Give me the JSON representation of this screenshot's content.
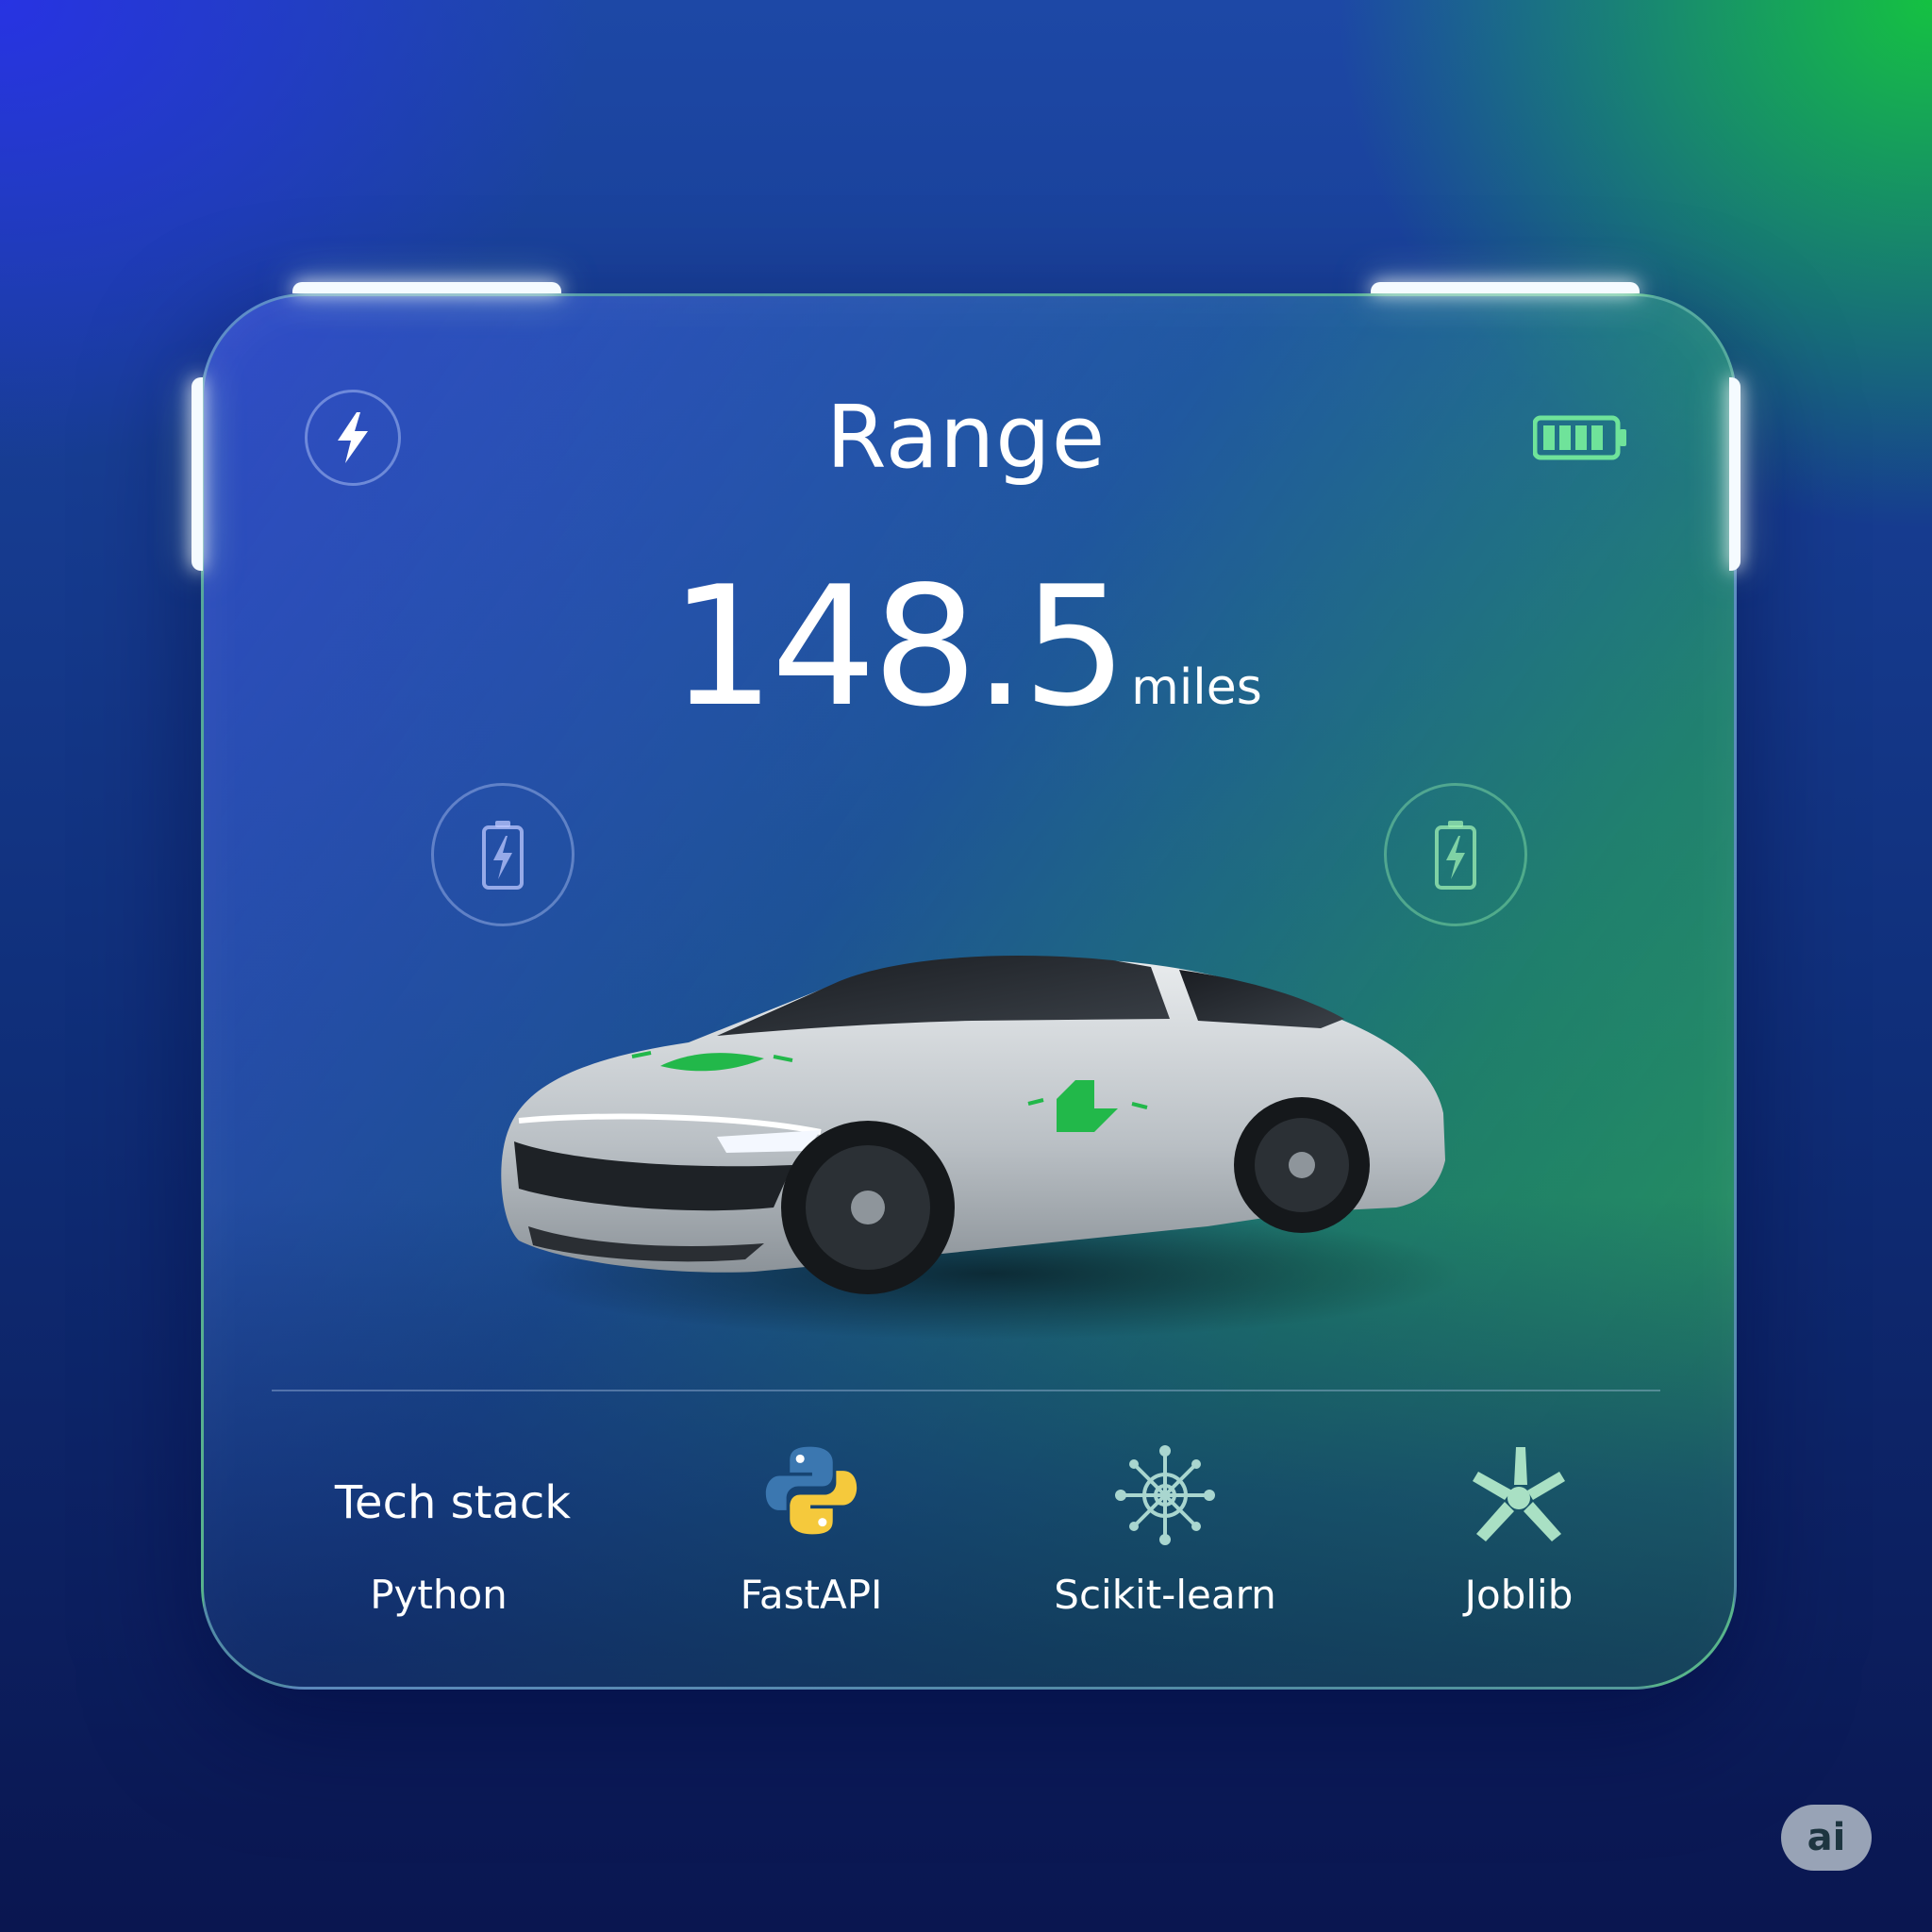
{
  "widget": {
    "title": "Range",
    "value": "148.5",
    "unit": "miles"
  },
  "icons": {
    "top_left": "lightning-bolt-icon",
    "top_right": "battery-full-icon",
    "left_circle": "battery-charging-icon",
    "right_circle": "battery-charging-icon"
  },
  "tech_stack": {
    "heading": "Tech stack",
    "items": [
      {
        "label": "Python",
        "icon": null
      },
      {
        "label": "FastAPI",
        "icon": "python-logo-icon"
      },
      {
        "label": "Scikit-learn",
        "icon": "network-snowflake-icon"
      },
      {
        "label": "Joblib",
        "icon": "joblib-star-icon"
      }
    ]
  },
  "badge": {
    "label": "ai"
  },
  "colors": {
    "accent_green": "#22c55e",
    "accent_blue": "#2a3fe0",
    "text": "#ffffff"
  }
}
